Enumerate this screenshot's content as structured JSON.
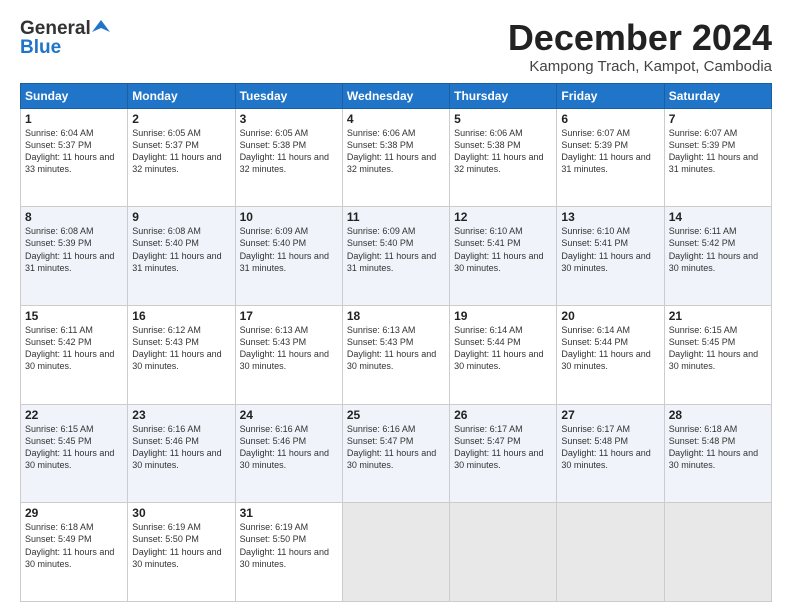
{
  "header": {
    "logo_general": "General",
    "logo_blue": "Blue",
    "month_title": "December 2024",
    "location": "Kampong Trach, Kampot, Cambodia"
  },
  "weekdays": [
    "Sunday",
    "Monday",
    "Tuesday",
    "Wednesday",
    "Thursday",
    "Friday",
    "Saturday"
  ],
  "weeks": [
    [
      {
        "day": "1",
        "sunrise": "6:04 AM",
        "sunset": "5:37 PM",
        "daylight": "11 hours and 33 minutes."
      },
      {
        "day": "2",
        "sunrise": "6:05 AM",
        "sunset": "5:37 PM",
        "daylight": "11 hours and 32 minutes."
      },
      {
        "day": "3",
        "sunrise": "6:05 AM",
        "sunset": "5:38 PM",
        "daylight": "11 hours and 32 minutes."
      },
      {
        "day": "4",
        "sunrise": "6:06 AM",
        "sunset": "5:38 PM",
        "daylight": "11 hours and 32 minutes."
      },
      {
        "day": "5",
        "sunrise": "6:06 AM",
        "sunset": "5:38 PM",
        "daylight": "11 hours and 32 minutes."
      },
      {
        "day": "6",
        "sunrise": "6:07 AM",
        "sunset": "5:39 PM",
        "daylight": "11 hours and 31 minutes."
      },
      {
        "day": "7",
        "sunrise": "6:07 AM",
        "sunset": "5:39 PM",
        "daylight": "11 hours and 31 minutes."
      }
    ],
    [
      {
        "day": "8",
        "sunrise": "6:08 AM",
        "sunset": "5:39 PM",
        "daylight": "11 hours and 31 minutes."
      },
      {
        "day": "9",
        "sunrise": "6:08 AM",
        "sunset": "5:40 PM",
        "daylight": "11 hours and 31 minutes."
      },
      {
        "day": "10",
        "sunrise": "6:09 AM",
        "sunset": "5:40 PM",
        "daylight": "11 hours and 31 minutes."
      },
      {
        "day": "11",
        "sunrise": "6:09 AM",
        "sunset": "5:40 PM",
        "daylight": "11 hours and 31 minutes."
      },
      {
        "day": "12",
        "sunrise": "6:10 AM",
        "sunset": "5:41 PM",
        "daylight": "11 hours and 30 minutes."
      },
      {
        "day": "13",
        "sunrise": "6:10 AM",
        "sunset": "5:41 PM",
        "daylight": "11 hours and 30 minutes."
      },
      {
        "day": "14",
        "sunrise": "6:11 AM",
        "sunset": "5:42 PM",
        "daylight": "11 hours and 30 minutes."
      }
    ],
    [
      {
        "day": "15",
        "sunrise": "6:11 AM",
        "sunset": "5:42 PM",
        "daylight": "11 hours and 30 minutes."
      },
      {
        "day": "16",
        "sunrise": "6:12 AM",
        "sunset": "5:43 PM",
        "daylight": "11 hours and 30 minutes."
      },
      {
        "day": "17",
        "sunrise": "6:13 AM",
        "sunset": "5:43 PM",
        "daylight": "11 hours and 30 minutes."
      },
      {
        "day": "18",
        "sunrise": "6:13 AM",
        "sunset": "5:43 PM",
        "daylight": "11 hours and 30 minutes."
      },
      {
        "day": "19",
        "sunrise": "6:14 AM",
        "sunset": "5:44 PM",
        "daylight": "11 hours and 30 minutes."
      },
      {
        "day": "20",
        "sunrise": "6:14 AM",
        "sunset": "5:44 PM",
        "daylight": "11 hours and 30 minutes."
      },
      {
        "day": "21",
        "sunrise": "6:15 AM",
        "sunset": "5:45 PM",
        "daylight": "11 hours and 30 minutes."
      }
    ],
    [
      {
        "day": "22",
        "sunrise": "6:15 AM",
        "sunset": "5:45 PM",
        "daylight": "11 hours and 30 minutes."
      },
      {
        "day": "23",
        "sunrise": "6:16 AM",
        "sunset": "5:46 PM",
        "daylight": "11 hours and 30 minutes."
      },
      {
        "day": "24",
        "sunrise": "6:16 AM",
        "sunset": "5:46 PM",
        "daylight": "11 hours and 30 minutes."
      },
      {
        "day": "25",
        "sunrise": "6:16 AM",
        "sunset": "5:47 PM",
        "daylight": "11 hours and 30 minutes."
      },
      {
        "day": "26",
        "sunrise": "6:17 AM",
        "sunset": "5:47 PM",
        "daylight": "11 hours and 30 minutes."
      },
      {
        "day": "27",
        "sunrise": "6:17 AM",
        "sunset": "5:48 PM",
        "daylight": "11 hours and 30 minutes."
      },
      {
        "day": "28",
        "sunrise": "6:18 AM",
        "sunset": "5:48 PM",
        "daylight": "11 hours and 30 minutes."
      }
    ],
    [
      {
        "day": "29",
        "sunrise": "6:18 AM",
        "sunset": "5:49 PM",
        "daylight": "11 hours and 30 minutes."
      },
      {
        "day": "30",
        "sunrise": "6:19 AM",
        "sunset": "5:50 PM",
        "daylight": "11 hours and 30 minutes."
      },
      {
        "day": "31",
        "sunrise": "6:19 AM",
        "sunset": "5:50 PM",
        "daylight": "11 hours and 30 minutes."
      },
      null,
      null,
      null,
      null
    ]
  ]
}
